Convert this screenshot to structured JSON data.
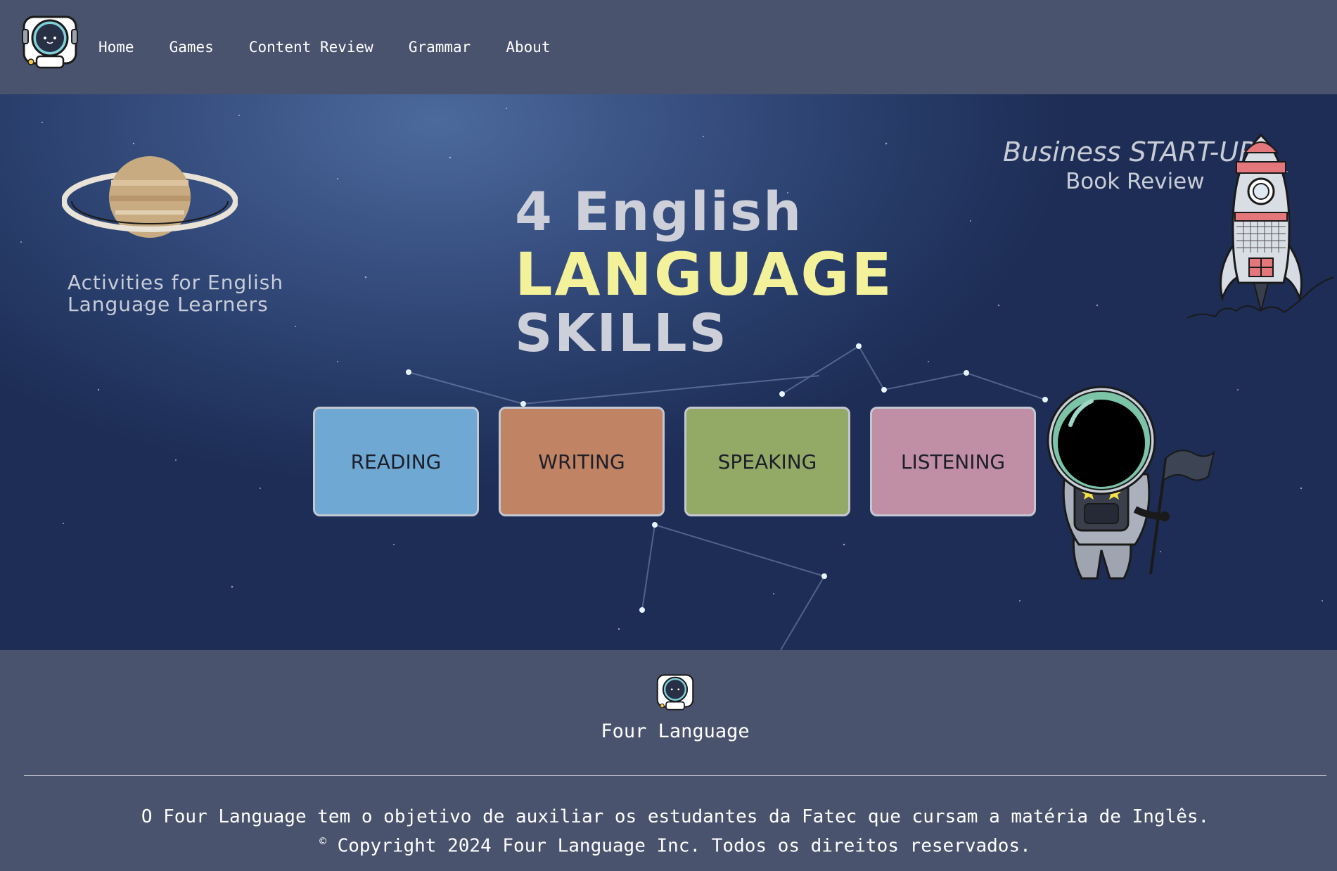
{
  "nav": {
    "logo_icon": "astronaut-logo-icon",
    "items": [
      {
        "label": "Home"
      },
      {
        "label": "Games"
      },
      {
        "label": "Content Review"
      },
      {
        "label": "Grammar"
      },
      {
        "label": "About"
      }
    ]
  },
  "hero": {
    "subtitle_line1": "Activities for English",
    "subtitle_line2": "Language Learners",
    "title_line1": "4 English",
    "title_line2": "LANGUAGE",
    "title_line3": "SKILLS",
    "promo_title": "Business START-UP",
    "promo_subtitle": "Book Review",
    "colors": {
      "title_accent": "#f3f19a",
      "title_main": "#cdd0d8"
    },
    "skills": [
      {
        "label": "READING",
        "color": "#6ea8d3"
      },
      {
        "label": "WRITING",
        "color": "#c08363"
      },
      {
        "label": "SPEAKING",
        "color": "#93aa67"
      },
      {
        "label": "LISTENING",
        "color": "#c08ea5"
      }
    ]
  },
  "footer": {
    "brand": "Four Language",
    "description": "O Four Language tem o objetivo de auxiliar os estudantes da Fatec que cursam a matéria de Inglês.",
    "copyright_symbol": "©",
    "copyright": "Copyright 2024 Four Language Inc. Todos os direitos reservados."
  },
  "colors": {
    "background": "#4a536d"
  }
}
